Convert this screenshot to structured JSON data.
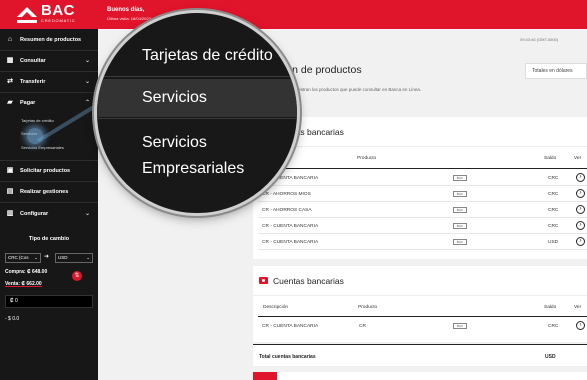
{
  "header": {
    "logo_text": "BAC",
    "logo_sub": "CREDOMATIC",
    "greeting": "Buenos días,",
    "last_visit": "Última visita: 18/04/2023"
  },
  "sidebar": {
    "items": [
      {
        "label": "Resumen de productos",
        "icon": "home-icon"
      },
      {
        "label": "Consultar",
        "icon": "grid-icon"
      },
      {
        "label": "Transferir",
        "icon": "transfer-icon"
      },
      {
        "label": "Pagar",
        "icon": "piggy-bank-icon"
      },
      {
        "label": "Solicitar productos",
        "icon": "request-icon"
      },
      {
        "label": "Realizar gestiones",
        "icon": "briefcase-icon"
      },
      {
        "label": "Configurar",
        "icon": "settings-icon"
      }
    ],
    "pagar_sub": [
      "Tarjetas de crédito",
      "Servicios",
      "Servicios Empresariales"
    ],
    "fx": {
      "title": "Tipo de cambio",
      "from": "CRC (Cos",
      "to": "USD",
      "buy": "Compra: ₡ 648.00",
      "sell": "Venta: ₡ 662.00",
      "input_value": "₡ 0",
      "result": "- $ 0.0"
    }
  },
  "main": {
    "timestamp": "09:43:46 (GMT-0600)",
    "title": "Resumen de productos",
    "description": "En esta sección se muestran los productos que puede consultar en Banca en Línea.",
    "currency_select": "Totales en dólares",
    "columns": {
      "description": "Descripción",
      "product": "Producto",
      "balance": "Saldo",
      "view": "Ver"
    },
    "cards": [
      {
        "title": "Cuentas bancarias",
        "rows": [
          {
            "description": "CR - CUENTA BANCARIA",
            "product": "",
            "badge": "BAC",
            "balance": "CRC"
          },
          {
            "description": "CR - AHORROS MIOS",
            "product": "",
            "badge": "BAC",
            "balance": "CRC"
          },
          {
            "description": "CR - AHORROS CASA",
            "product": "",
            "badge": "BAC",
            "balance": "CRC"
          },
          {
            "description": "CR - CUENTA BANCARIA",
            "product": "",
            "badge": "BAC",
            "balance": "CRC"
          },
          {
            "description": "CR - CUENTA BANCARIA",
            "product": "",
            "badge": "BAC",
            "balance": "USD"
          }
        ]
      },
      {
        "title": "Cuentas bancarias",
        "rows": [
          {
            "description": "CR - CUENTA BANCARIA",
            "product": "CR",
            "badge": "BAC",
            "balance": "CRC"
          }
        ]
      }
    ],
    "total_label": "Total cuentas bancarias",
    "total_currency": "USD"
  },
  "magnifier": {
    "items": [
      "Tarjetas de crédito",
      "Servicios",
      "Servicios Empresariales"
    ],
    "active_index": 1
  },
  "colors": {
    "brand": "#e0142a",
    "sidebar": "#171717"
  }
}
